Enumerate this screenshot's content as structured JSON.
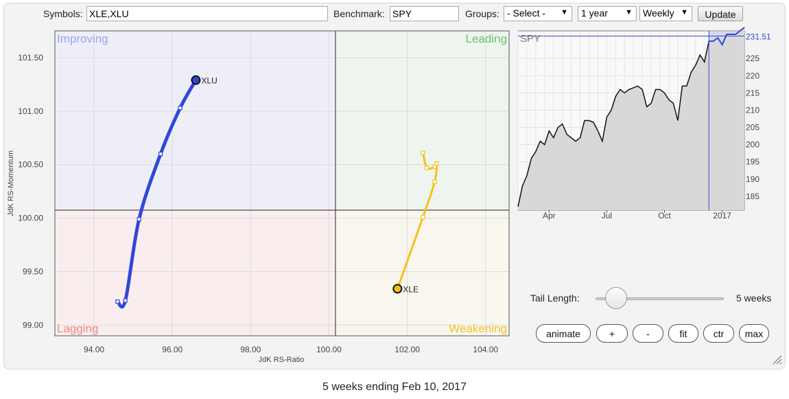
{
  "toolbar": {
    "symbols_label": "Symbols:",
    "symbols_value": "XLE,XLU",
    "benchmark_label": "Benchmark:",
    "benchmark_value": "SPY",
    "groups_label": "Groups:",
    "groups_selected": "- Select -",
    "period_selected": "1 year",
    "interval_selected": "Weekly",
    "update_label": "Update"
  },
  "rrg": {
    "quadrants": {
      "improving": "Improving",
      "leading": "Leading",
      "lagging": "Lagging",
      "weakening": "Weakening"
    },
    "x_axis_label": "JdK RS-Ratio",
    "y_axis_label": "JdK RS-Momentum",
    "colors": {
      "improving": "#9aa6e8",
      "leading": "#6cbf73",
      "lagging": "#f08a8a",
      "weakening": "#f2c230"
    }
  },
  "chart_data": [
    {
      "type": "scatter",
      "xlabel": "JdK RS-Ratio",
      "ylabel": "JdK RS-Momentum",
      "xlim": [
        93.0,
        104.6
      ],
      "ylim": [
        98.9,
        101.75
      ],
      "x_ticks": [
        "94.00",
        "96.00",
        "98.00",
        "100.00",
        "102.00",
        "104.00"
      ],
      "y_ticks": [
        "99.00",
        "99.50",
        "100.00",
        "100.50",
        "101.00",
        "101.50"
      ],
      "series": [
        {
          "name": "XLU",
          "color": "#3347d6",
          "x": [
            94.6,
            94.8,
            95.15,
            95.7,
            96.2,
            96.6
          ],
          "y": [
            99.22,
            99.23,
            99.99,
            100.6,
            101.03,
            101.29
          ]
        },
        {
          "name": "XLE",
          "color": "#f5c018",
          "x": [
            102.4,
            102.5,
            102.7,
            102.75,
            102.7,
            102.4,
            101.75
          ],
          "y": [
            100.61,
            100.47,
            100.48,
            100.51,
            100.34,
            100.01,
            99.34
          ]
        }
      ]
    },
    {
      "type": "area",
      "title": "SPY",
      "last_value_label": "231.51",
      "x_ticks": [
        "Apr",
        "Jul",
        "Oct",
        "2017"
      ],
      "y_ticks": [
        "185",
        "190",
        "195",
        "200",
        "205",
        "210",
        "215",
        "220",
        "225"
      ],
      "ylim": [
        181,
        233
      ],
      "x": [
        0,
        1,
        2,
        3,
        4,
        5,
        6,
        7,
        8,
        9,
        10,
        11,
        12,
        13,
        14,
        15,
        16,
        17,
        18,
        19,
        20,
        21,
        22,
        23,
        24,
        25,
        26,
        27,
        28,
        29,
        30,
        31,
        32,
        33,
        34,
        35,
        36,
        37,
        38,
        39,
        40,
        41,
        42,
        43,
        44,
        45,
        46,
        47,
        48,
        49,
        50,
        51
      ],
      "values": [
        182,
        188,
        191,
        196,
        198,
        201,
        200,
        204,
        202,
        205,
        206,
        203,
        202,
        201,
        202,
        207,
        207,
        206.5,
        204,
        201,
        208,
        210,
        214,
        216,
        215,
        216,
        216.5,
        217,
        216,
        211,
        212,
        216,
        216,
        215,
        213,
        212,
        207,
        217,
        217,
        221,
        223,
        226,
        224,
        230,
        230,
        231,
        229,
        232,
        232,
        232,
        233,
        234
      ],
      "highlight_from": 43,
      "highlight_color": "#3347d6"
    }
  ],
  "controls": {
    "tail_length_label": "Tail Length:",
    "tail_length_value": "5 weeks",
    "tail_fraction": 0.12,
    "buttons": {
      "animate": "animate",
      "plus": "+",
      "minus": "-",
      "fit": "fit",
      "ctr": "ctr",
      "max": "max"
    }
  },
  "caption": "5 weeks ending Feb 10, 2017"
}
